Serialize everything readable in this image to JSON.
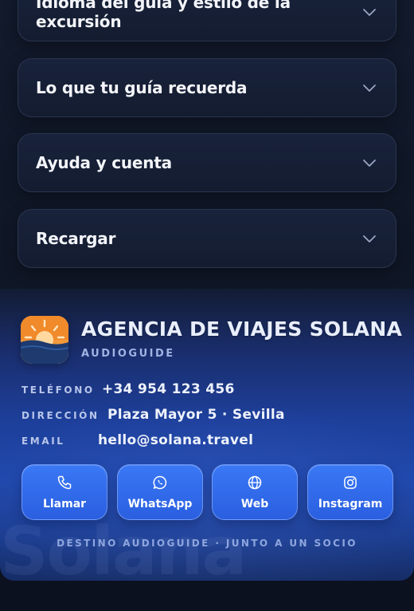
{
  "accordions": [
    {
      "label": "Idioma del guía y estilo de la excursión"
    },
    {
      "label": "Lo que tu guía recuerda"
    },
    {
      "label": "Ayuda y cuenta"
    },
    {
      "label": "Recargar"
    }
  ],
  "footer": {
    "brand_name": "AGENCIA DE VIAJES SOLANA",
    "brand_sub": "AUDIOGUIDE",
    "watermark": "Solana",
    "contact": {
      "phone_label": "TELÉFONO",
      "phone_value": "+34 954 123 456",
      "address_label": "DIRECCIÓN",
      "address_value": "Plaza Mayor 5 · Sevilla",
      "email_label": "EMAIL",
      "email_value": "hello@solana.travel"
    },
    "buttons": [
      {
        "label": "Llamar",
        "icon": "phone-icon"
      },
      {
        "label": "WhatsApp",
        "icon": "whatsapp-icon"
      },
      {
        "label": "Web",
        "icon": "globe-icon"
      },
      {
        "label": "Instagram",
        "icon": "instagram-icon"
      }
    ],
    "tagline": "DESTINO AUDIOGUIDE · JUNTO A UN SOCIO"
  },
  "colors": {
    "background": "#0c1120",
    "card": "#18223a",
    "accent_blue": "#2a5fe0",
    "logo_orange": "#f08a2a",
    "logo_navy": "#1e3a6e"
  }
}
